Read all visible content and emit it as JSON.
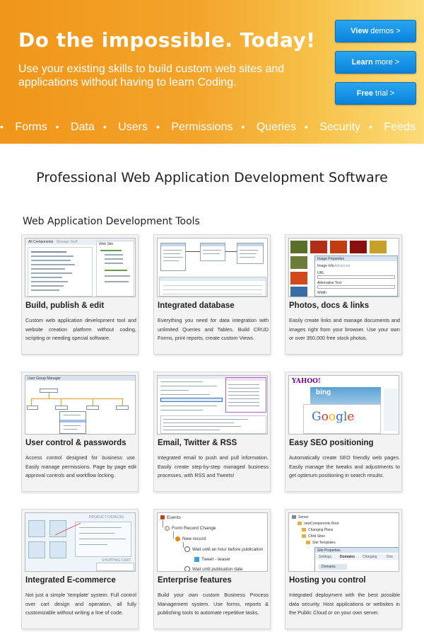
{
  "hero": {
    "title": "Do the impossible.  Today!",
    "subtitle": "Use your existing skills to build custom web sites and applications without having to learn Coding.",
    "buttons": [
      {
        "strong": "View",
        "rest": " demos >"
      },
      {
        "strong": "Learn",
        "rest": " more >"
      },
      {
        "strong": "Free",
        "rest": " trial >"
      }
    ],
    "ticker": [
      "Forms",
      "Data",
      "Users",
      "Permissions",
      "Queries",
      "Security",
      "Feeds"
    ]
  },
  "main_title": "Professional Web Application Development Software",
  "section_title": "Web Application Development Tools",
  "cards": [
    {
      "title": "Build, publish & edit",
      "desc": "Custom web application development tool and website creation platform without coding, scripting or needing special software.",
      "shot": "builder"
    },
    {
      "title": "Integrated database",
      "desc": "Everything you need for data integration with unlimited Queries and Tables. Build CRUD Forms, print reports, create custom Views.",
      "shot": "database"
    },
    {
      "title": "Photos, docs & links",
      "desc": "Easily create links and manage documents and images right from your browser. Use your own or over 350,000 free stock photos.",
      "shot": "photos"
    },
    {
      "title": "User control & passwords",
      "desc": "Access control designed for business use. Easily manage permissions. Page by page edit approval controls and workflow locking.",
      "shot": "users"
    },
    {
      "title": "Email, Twitter & RSS",
      "desc": "Integrated email to push and pull information. Easily create step-by-step managed business processes, with RSS and Tweets!",
      "shot": "email"
    },
    {
      "title": "Easy SEO positioning",
      "desc": "Automatically create SEO friendly web pages. Easily manage the tweaks and adjustments to get optimum positioning in search results.",
      "shot": "seo"
    },
    {
      "title": "Integrated E-commerce",
      "desc": "Not just a simple 'template' system. Full control over cart design and operation, all fully customizable without writing a line of code.",
      "shot": "ecommerce"
    },
    {
      "title": "Enterprise features",
      "desc": "Build your own custom Business Process Management system. Use forms, reports & publishing tools to automate repetitive tasks.",
      "shot": "enterprise"
    },
    {
      "title": "Hosting you control",
      "desc": "Integrated deployment with the best possible data security. Host applications or websites in the Public Cloud or on your own server.",
      "shot": "hosting"
    }
  ],
  "shot_text": {
    "builder": {
      "tab1": "All Components",
      "tab2": "Manage Stuff",
      "side": "Web Site"
    },
    "photos": {
      "panel": "Image Properties",
      "tab": "Image Info",
      "tab2": "Advanced",
      "url": "URL",
      "alt": "Alternative Text",
      "width": "Width"
    },
    "users": {
      "title": "User Group Manager"
    },
    "seo": {
      "yahoo": "YAHOO!",
      "bing": "bing",
      "google": "Google"
    },
    "ecommerce": {
      "catalog": "PRODUCT CATALOG",
      "cart": "SHOPPING CART"
    },
    "enterprise": {
      "root": "Events",
      "n1": "Form Record Change",
      "n2": "New record",
      "n3": "Wait until an hour before publication",
      "n4": "Tweet - teaser",
      "n5": "Wait until publication date"
    },
    "hosting": {
      "root": "Server",
      "items": [
        "newComponents Root",
        "Changing Plans",
        "Child Sites",
        "Site Templates"
      ],
      "panel": "Site Properties",
      "tabs": [
        "Settings",
        "Domains",
        "Charging",
        "Dos"
      ],
      "sub": "Domains"
    }
  },
  "colors": {
    "button_blue": "#0a83dc",
    "hero_orange": "#f0961a"
  }
}
